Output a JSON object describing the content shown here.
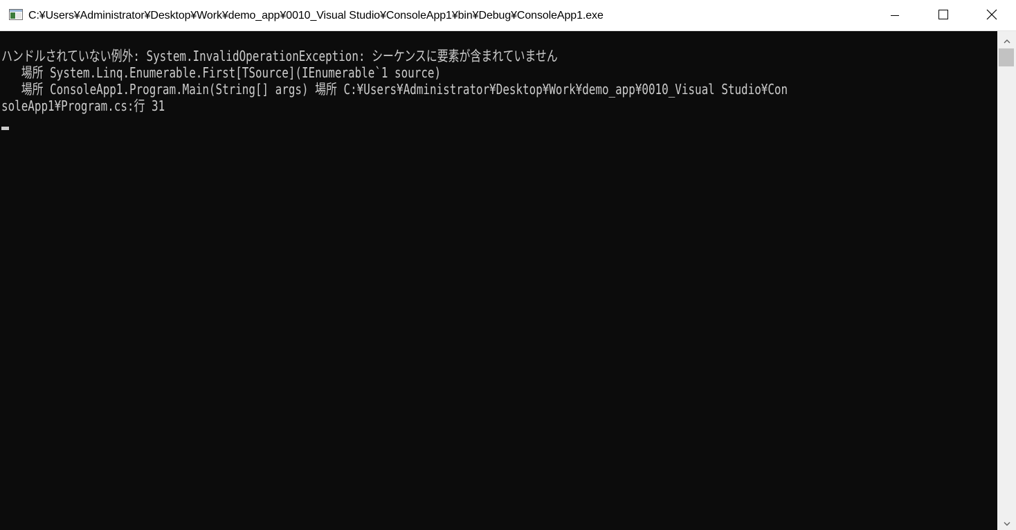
{
  "window": {
    "title": "C:¥Users¥Administrator¥Desktop¥Work¥demo_app¥0010_Visual Studio¥ConsoleApp1¥bin¥Debug¥ConsoleApp1.exe",
    "icon": "console-app-icon",
    "controls": {
      "minimize_icon": "minimize-icon",
      "maximize_icon": "maximize-icon",
      "close_icon": "close-icon"
    }
  },
  "console": {
    "background": "#0c0c0c",
    "foreground": "#cccccc",
    "lines": [
      "ハンドルされていない例外: System.InvalidOperationException: シーケンスに要素が含まれていません",
      "   場所 System.Linq.Enumerable.First[TSource](IEnumerable`1 source)",
      "   場所 ConsoleApp1.Program.Main(String[] args) 場所 C:¥Users¥Administrator¥Desktop¥Work¥demo_app¥0010_Visual Studio¥Con",
      "soleApp1¥Program.cs:行 31"
    ]
  },
  "scrollbar": {
    "up_icon": "scroll-up-arrow-icon",
    "down_icon": "scroll-down-arrow-icon"
  }
}
